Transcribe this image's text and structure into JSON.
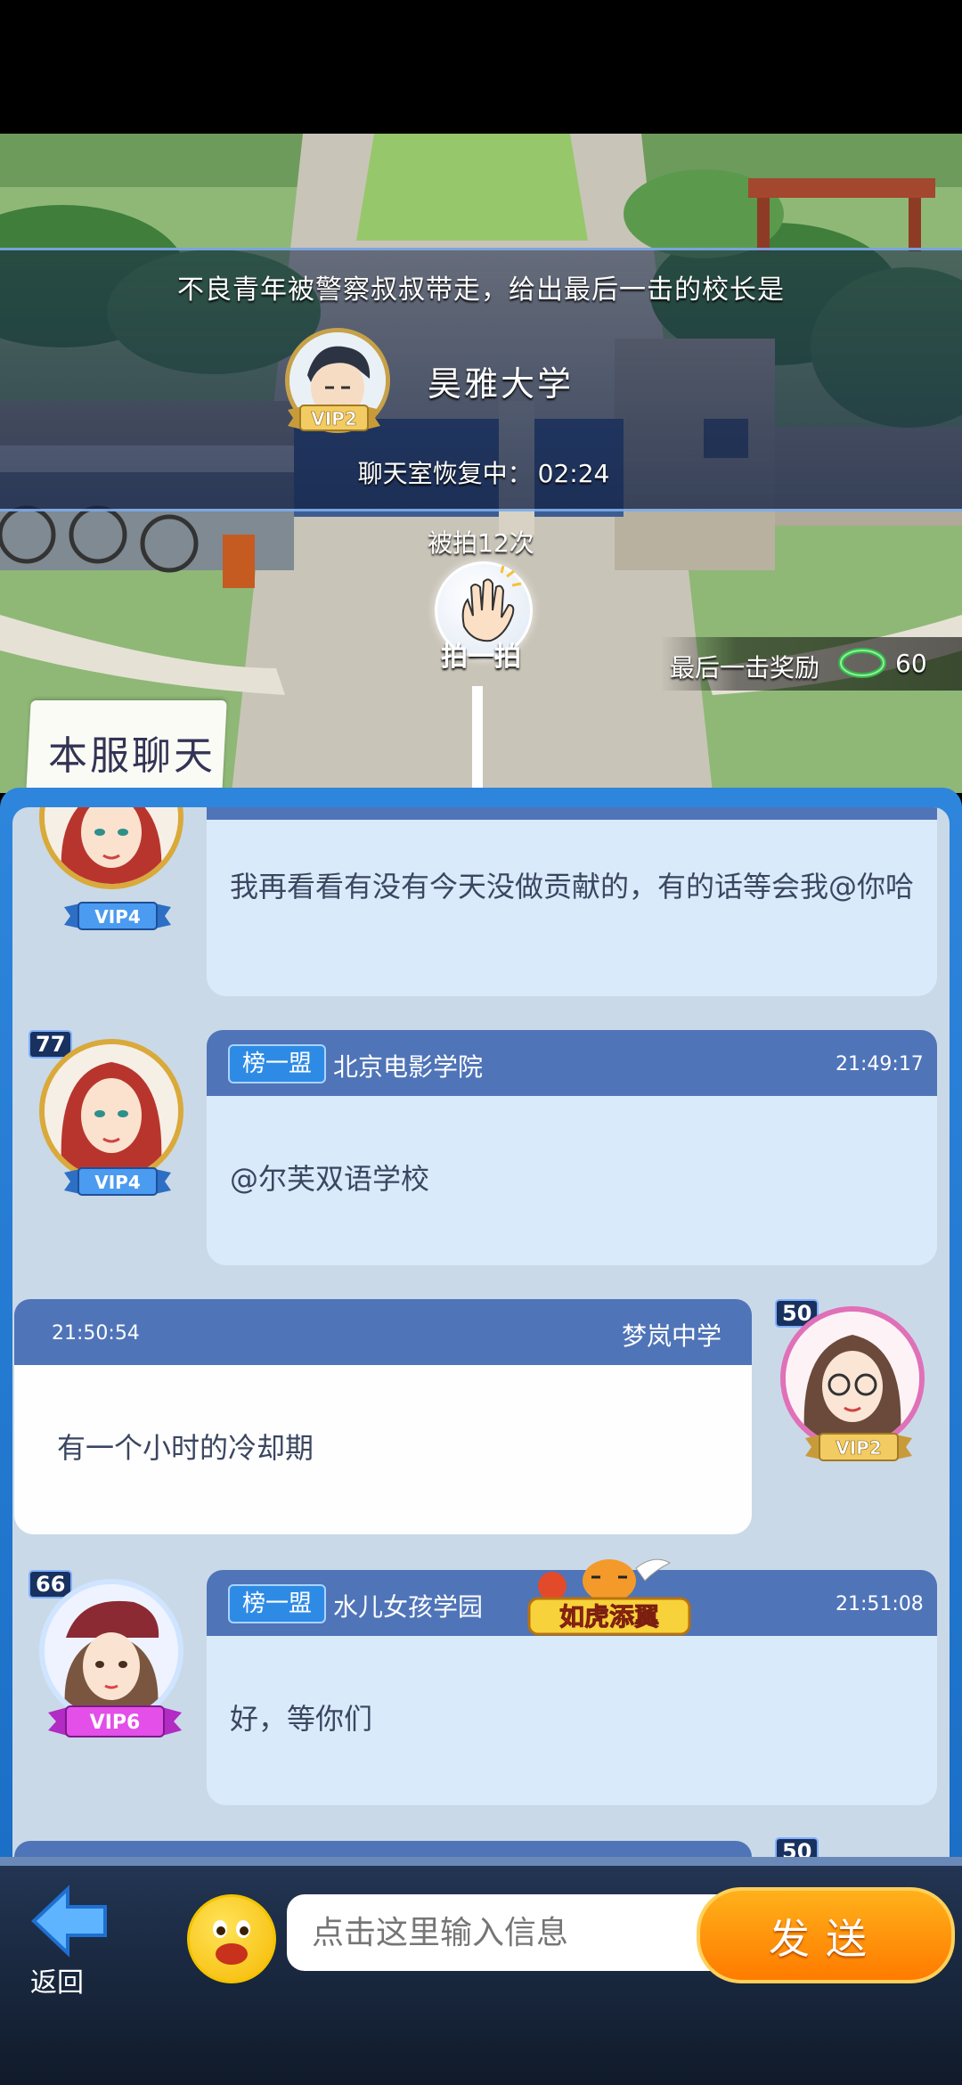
{
  "scene": {
    "notice": "不良青年被警察叔叔带走，给出最后一击的校长是",
    "leader_name": "昊雅大学",
    "leader_vip": "VIP2",
    "recovering_label": "聊天室恢复中：",
    "recovering_time": "02:24",
    "pat_count": "被拍12次",
    "pat_button": "拍一拍",
    "reward_label": "最后一击奖励",
    "reward_value": "60",
    "reward_icon": "green-ring-icon",
    "colors": {
      "banner": "#1c2c52",
      "accent": "#2e86dc"
    }
  },
  "chat": {
    "tab_label": "本服聊天",
    "messages": [
      {
        "text": "我再看看有没有今天没做贡献的，有的话等会我@你哈",
        "vip": "VIP4"
      },
      {
        "level": "77",
        "union": "榜一盟",
        "school": "北京电影学院",
        "time": "21:49:17",
        "text": "@尔芙双语学校",
        "vip": "VIP4"
      },
      {
        "level": "50",
        "school": "梦岚中学",
        "time": "21:50:54",
        "text": "有一个小时的冷却期",
        "vip": "VIP2"
      },
      {
        "level": "66",
        "union": "榜一盟",
        "school": "水儿女孩学园",
        "badge": "如虎添翼",
        "time": "21:51:08",
        "text": "好，等你们",
        "vip": "VIP6"
      },
      {
        "level": "50"
      }
    ]
  },
  "bottom": {
    "back_label": "返回",
    "input_placeholder": "点击这里输入信息",
    "send_label": "发送"
  }
}
